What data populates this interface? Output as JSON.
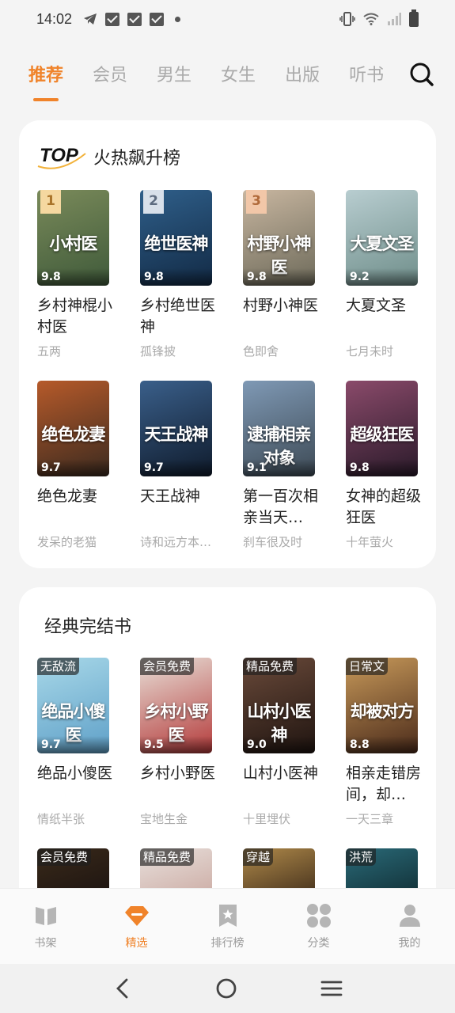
{
  "status_bar": {
    "time": "14:02"
  },
  "tabs": [
    {
      "label": "推荐",
      "active": true
    },
    {
      "label": "会员"
    },
    {
      "label": "男生"
    },
    {
      "label": "女生"
    },
    {
      "label": "出版"
    },
    {
      "label": "听书"
    }
  ],
  "hot_section": {
    "logo_text": "TOP",
    "title": "火热飙升榜",
    "books": [
      {
        "rank": "1",
        "cover_text": "小村医",
        "score": "9.8",
        "name": "乡村神棍小村医",
        "author": "五两",
        "colors": [
          "#7a8a5a",
          "#3f5a3a"
        ]
      },
      {
        "rank": "2",
        "cover_text": "绝世医神",
        "score": "9.8",
        "name": "乡村绝世医神",
        "author": "孤锋披",
        "colors": [
          "#2f5f8a",
          "#122a45"
        ]
      },
      {
        "rank": "3",
        "cover_text": "村野小神医",
        "score": "9.8",
        "name": "村野小神医",
        "author": "色即舍",
        "colors": [
          "#c8b6a0",
          "#6d6a5a"
        ]
      },
      {
        "rank": "",
        "cover_text": "大夏文圣",
        "score": "9.2",
        "name": "大夏文圣",
        "author": "七月未时",
        "colors": [
          "#b8cdd0",
          "#6f8e8a"
        ]
      },
      {
        "rank": "",
        "cover_text": "绝色龙妻",
        "score": "9.7",
        "name": "绝色龙妻",
        "author": "发呆的老猫",
        "colors": [
          "#b65a2a",
          "#3b2a1f"
        ]
      },
      {
        "rank": "",
        "cover_text": "天王战神",
        "score": "9.7",
        "name": "天王战神",
        "author": "诗和远方本…",
        "colors": [
          "#3a5f8a",
          "#0f1b2c"
        ]
      },
      {
        "rank": "",
        "cover_text": "逮捕相亲对象",
        "score": "9.1",
        "name": "第一百次相亲当天…",
        "author": "刹车很及时",
        "colors": [
          "#7f99b5",
          "#3d4a55"
        ]
      },
      {
        "rank": "",
        "cover_text": "超级狂医",
        "score": "9.8",
        "name": "女神的超级狂医",
        "author": "十年萤火",
        "colors": [
          "#8a4a6a",
          "#2a1a2a"
        ]
      }
    ]
  },
  "classic_section": {
    "title": "经典完结书",
    "books": [
      {
        "tag": "无敌流",
        "cover_text": "绝品小傻医",
        "score": "9.7",
        "name": "绝品小傻医",
        "author": "情纸半张",
        "colors": [
          "#a8d8e8",
          "#5fa0c8"
        ]
      },
      {
        "tag": "会员免费",
        "cover_text": "乡村小野医",
        "score": "9.5",
        "name": "乡村小野医",
        "author": "宝地生金",
        "colors": [
          "#e8e0d8",
          "#b43a3a"
        ]
      },
      {
        "tag": "精品免费",
        "cover_text": "山村小医神",
        "score": "9.0",
        "name": "山村小医神",
        "author": "十里埋伏",
        "colors": [
          "#6a4a3a",
          "#1f1410"
        ]
      },
      {
        "tag": "日常文",
        "cover_text": "却被对方",
        "score": "8.8",
        "name": "相亲走错房间，却…",
        "author": "一天三章",
        "colors": [
          "#c89a5a",
          "#4a2a1a"
        ]
      }
    ],
    "partial_tags": [
      "会员免费",
      "精品免费",
      "穿越",
      "洪荒"
    ]
  },
  "bottom_nav": [
    {
      "label": "书架",
      "icon": "book-icon"
    },
    {
      "label": "精选",
      "icon": "diamond-icon",
      "active": true
    },
    {
      "label": "排行榜",
      "icon": "bookmark-icon"
    },
    {
      "label": "分类",
      "icon": "grid-icon"
    },
    {
      "label": "我的",
      "icon": "user-icon"
    }
  ],
  "colors": {
    "accent": "#f0832a",
    "background": "#f4f4f4",
    "card": "#ffffff"
  }
}
